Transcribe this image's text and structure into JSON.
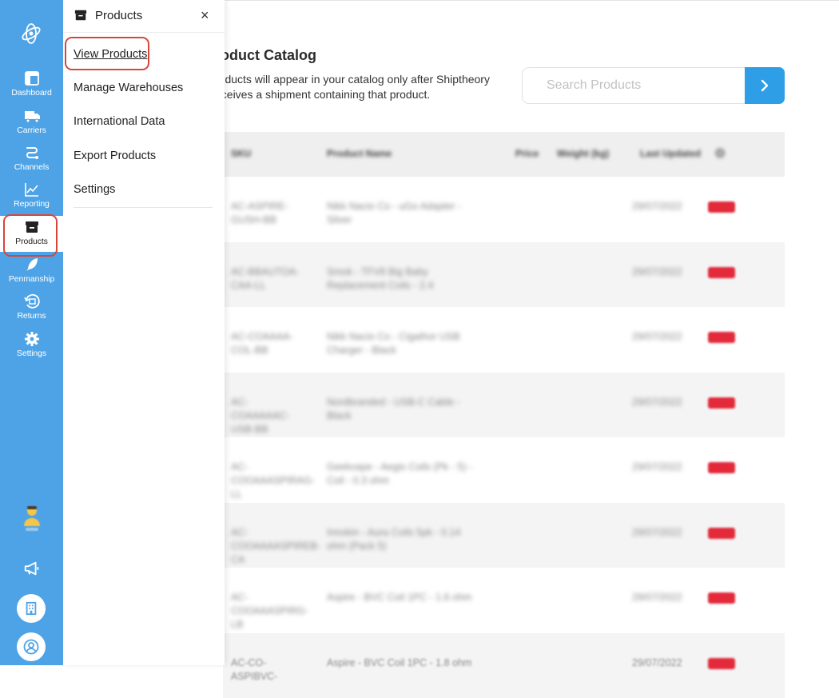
{
  "sidebar": {
    "items": [
      {
        "label": "Dashboard",
        "icon": "dashboard-icon"
      },
      {
        "label": "Carriers",
        "icon": "truck-icon"
      },
      {
        "label": "Channels",
        "icon": "channels-icon"
      },
      {
        "label": "Reporting",
        "icon": "chart-line-icon"
      },
      {
        "label": "Products",
        "icon": "archive-box-icon",
        "active": true
      },
      {
        "label": "Penmanship",
        "icon": "feather-pen-icon"
      },
      {
        "label": "Returns",
        "icon": "return-box-icon"
      },
      {
        "label": "Settings",
        "icon": "gear-icon"
      }
    ],
    "bottom": [
      "support-agent-icon",
      "megaphone-icon",
      "building-icon",
      "user-icon"
    ]
  },
  "flyout": {
    "title": "Products",
    "close_label": "×",
    "items": [
      {
        "label": "View Products",
        "current": true
      },
      {
        "label": "Manage Warehouses"
      },
      {
        "label": "International Data"
      },
      {
        "label": "Export Products"
      },
      {
        "label": "Settings"
      }
    ]
  },
  "main": {
    "title": "roduct Catalog",
    "description": "roducts will appear in your catalog only after Shiptheory eceives a shipment containing that product.",
    "search": {
      "placeholder": "Search Products",
      "value": ""
    },
    "table": {
      "columns": [
        "SKU",
        "Product Name",
        "Price",
        "Weight (kg)",
        "Last Updated",
        "⚙"
      ],
      "rows": [
        {
          "sku": "AC-ASPIRE-GUSH-BB",
          "name": "Nikk Nacio Co - uGo Adapter - Silver",
          "updated": "29/07/2022"
        },
        {
          "sku": "AC-BBAUTOA-CAA-LL",
          "name": "Smok - TFV8 Big Baby Replacement Coils - 2.4",
          "updated": "29/07/2022"
        },
        {
          "sku": "AC-COAAAA-COL-BB",
          "name": "Nikk Nacio Co - Cigathor USB Charger - Black",
          "updated": "29/07/2022"
        },
        {
          "sku": "AC-COAAAAAC-USB-BB",
          "name": "Nordbranded - USB-C Cable - Black",
          "updated": "29/07/2022"
        },
        {
          "sku": "AC-COOAAASPIRAG-LL",
          "name": "Geekvape - Aegis Coils (Pk - 5) - Coil - 0.3 ohm",
          "updated": "29/07/2022"
        },
        {
          "sku": "AC-COOAAAASPIREB-CA",
          "name": "Innokin - Aura Coils 5pk - 0.14 ohm (Pack 5)",
          "updated": "29/07/2022"
        },
        {
          "sku": "AC-COOAAASPIRG-LB",
          "name": "Aspire - BVC Coil 1PC - 1.6 ohm",
          "updated": "29/07/2022"
        },
        {
          "sku": "AC-CO-ASPIBVC-",
          "name": "Aspire - BVC Coil 1PC - 1.8 ohm",
          "updated": "29/07/2022"
        }
      ]
    }
  },
  "colors": {
    "rail": "#4ea3e6",
    "accent": "#2e9fe6",
    "highlight": "#d6473a",
    "badge": "#e22a3a"
  }
}
